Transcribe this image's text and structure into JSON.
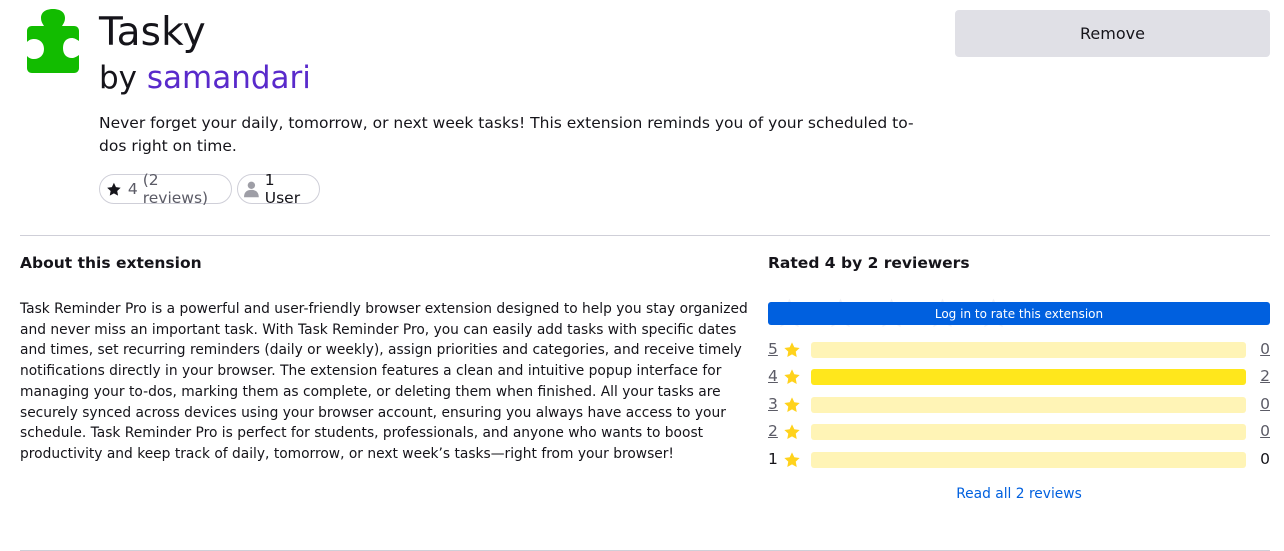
{
  "addon": {
    "name": "Tasky",
    "by_prefix": "by ",
    "author": "samandari",
    "summary": "Never forget your daily, tomorrow, or next week tasks! This extension reminds you of your scheduled to-dos right on time.",
    "remove_label": "Remove",
    "rating_value": "4",
    "rating_reviews": "(2 reviews)",
    "users_label": "1 User",
    "icon_color": "#12bc00"
  },
  "about": {
    "heading": "About this extension",
    "body": "Task Reminder Pro is a powerful and user-friendly browser extension designed to help you stay organized and never miss an important task. With Task Reminder Pro, you can easily add tasks with specific dates and times, set recurring reminders (daily or weekly), assign priorities and categories, and receive timely notifications directly in your browser. The extension features a clean and intuitive popup interface for managing your to-dos, marking them as complete, or deleting them when finished. All your tasks are securely synced across devices using your browser account, ensuring you always have access to your schedule. Task Reminder Pro is perfect for students, professionals, and anyone who wants to boost productivity and keep track of daily, tomorrow, or next week’s tasks—right from your browser!"
  },
  "ratings": {
    "heading": "Rated 4 by 2 reviewers",
    "login_label": "Log in to rate this extension",
    "read_all": "Read all 2 reviews",
    "rows": [
      {
        "stars": "5",
        "count": "0",
        "fraction": 0
      },
      {
        "stars": "4",
        "count": "2",
        "fraction": 1
      },
      {
        "stars": "3",
        "count": "0",
        "fraction": 0
      },
      {
        "stars": "2",
        "count": "0",
        "fraction": 0
      },
      {
        "stars": "1",
        "count": "0",
        "fraction": 0
      }
    ]
  },
  "colors": {
    "author_link": "#592acb",
    "accent_blue": "#0060df",
    "bar_fill": "#ffe71c",
    "bar_bg": "#fff4b6",
    "star": "#ffd21c"
  }
}
